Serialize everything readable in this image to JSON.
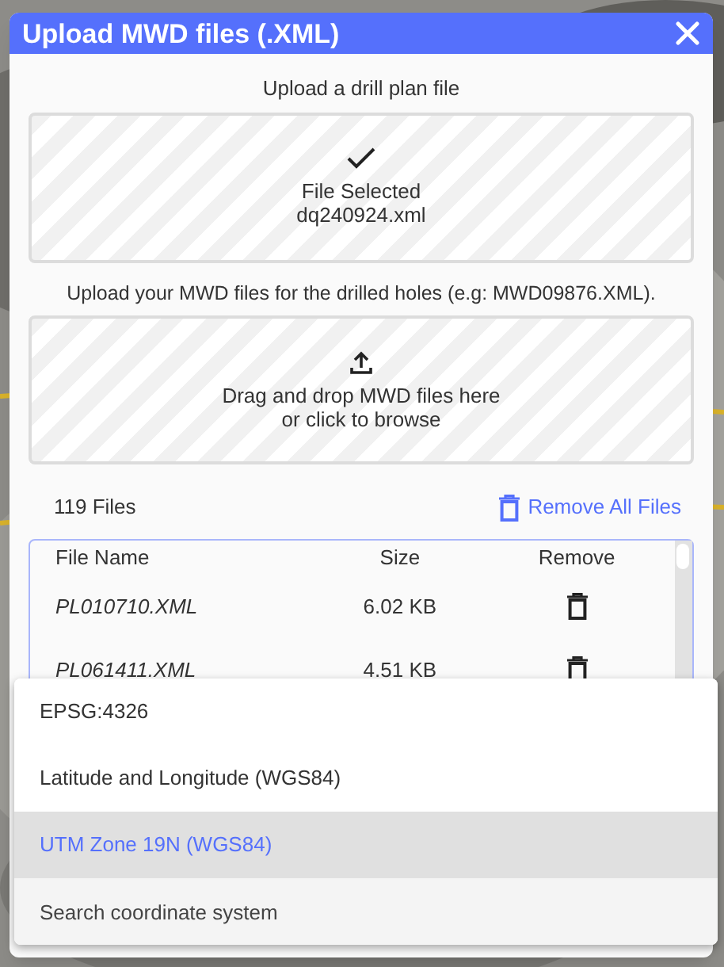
{
  "dialog": {
    "title": "Upload MWD files (.XML)",
    "drill_plan": {
      "label": "Upload a drill plan file",
      "status": "File Selected",
      "file_name": "dq240924.xml"
    },
    "mwd_upload": {
      "label": "Upload your MWD files for the drilled holes (e.g: MWD09876.XML).",
      "prompt_line_1": "Drag and drop MWD files here",
      "prompt_line_2": "or click to browse"
    },
    "file_count": "119 Files",
    "remove_all": "Remove All Files",
    "table": {
      "columns": [
        "File Name",
        "Size",
        "Remove"
      ],
      "rows": [
        {
          "file_name": "PL010710.XML",
          "size": "6.02 KB"
        },
        {
          "file_name": "PL061411.XML",
          "size": "4.51 KB"
        }
      ]
    }
  },
  "dropdown": {
    "items": [
      {
        "label": "EPSG:4326",
        "selected": false
      },
      {
        "label": "Latitude and Longitude (WGS84)",
        "selected": false
      },
      {
        "label": "UTM Zone 19N (WGS84)",
        "selected": true
      }
    ],
    "search": {
      "placeholder": "Search coordinate system"
    }
  }
}
